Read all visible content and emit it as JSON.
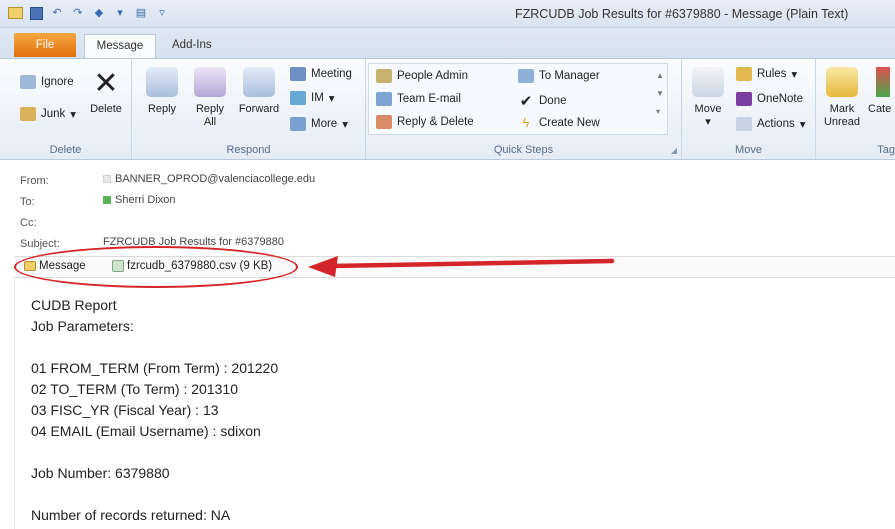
{
  "window": {
    "title": "FZRCUDB Job Results for #6379880 - Message (Plain Text)"
  },
  "tabs": {
    "file": "File",
    "message": "Message",
    "addins": "Add-Ins"
  },
  "ribbon": {
    "delete_group": {
      "label": "Delete",
      "ignore": "Ignore",
      "junk": "Junk",
      "delete": "Delete"
    },
    "respond_group": {
      "label": "Respond",
      "reply": "Reply",
      "reply_all_1": "Reply",
      "reply_all_2": "All",
      "forward": "Forward",
      "meeting": "Meeting",
      "im": "IM",
      "more": "More"
    },
    "quicksteps_group": {
      "label": "Quick Steps",
      "people_admin": "People Admin",
      "team_email": "Team E-mail",
      "reply_delete": "Reply & Delete",
      "to_manager": "To Manager",
      "done": "Done",
      "create_new": "Create New"
    },
    "move_group": {
      "label": "Move",
      "move": "Move",
      "rules": "Rules",
      "onenote": "OneNote",
      "actions": "Actions"
    },
    "tags_group": {
      "label": "Tag",
      "mark_unread_1": "Mark",
      "mark_unread_2": "Unread",
      "categorize": "Cate"
    }
  },
  "header": {
    "from_label": "From:",
    "from_value": "BANNER_OPROD@valenciacollege.edu",
    "to_label": "To:",
    "to_value": "Sherri Dixon",
    "cc_label": "Cc:",
    "subject_label": "Subject:",
    "subject_value": "FZRCUDB Job Results for #6379880"
  },
  "attachments": {
    "message_tab": "Message",
    "file_name": "fzrcudb_6379880.csv (9 KB)"
  },
  "body": {
    "lines": [
      "CUDB Report",
      "Job Parameters:",
      "01 FROM_TERM (From Term) : 201220",
      "02 TO_TERM (To Term) : 201310",
      "03 FISC_YR (Fiscal Year) : 13",
      "04 EMAIL (Email Username) : sdixon",
      "Job Number: 6379880",
      "Number of records returned: NA"
    ]
  },
  "colors": {
    "annotation_red": "#d4262a",
    "file_tab_orange": "#e0710b"
  }
}
